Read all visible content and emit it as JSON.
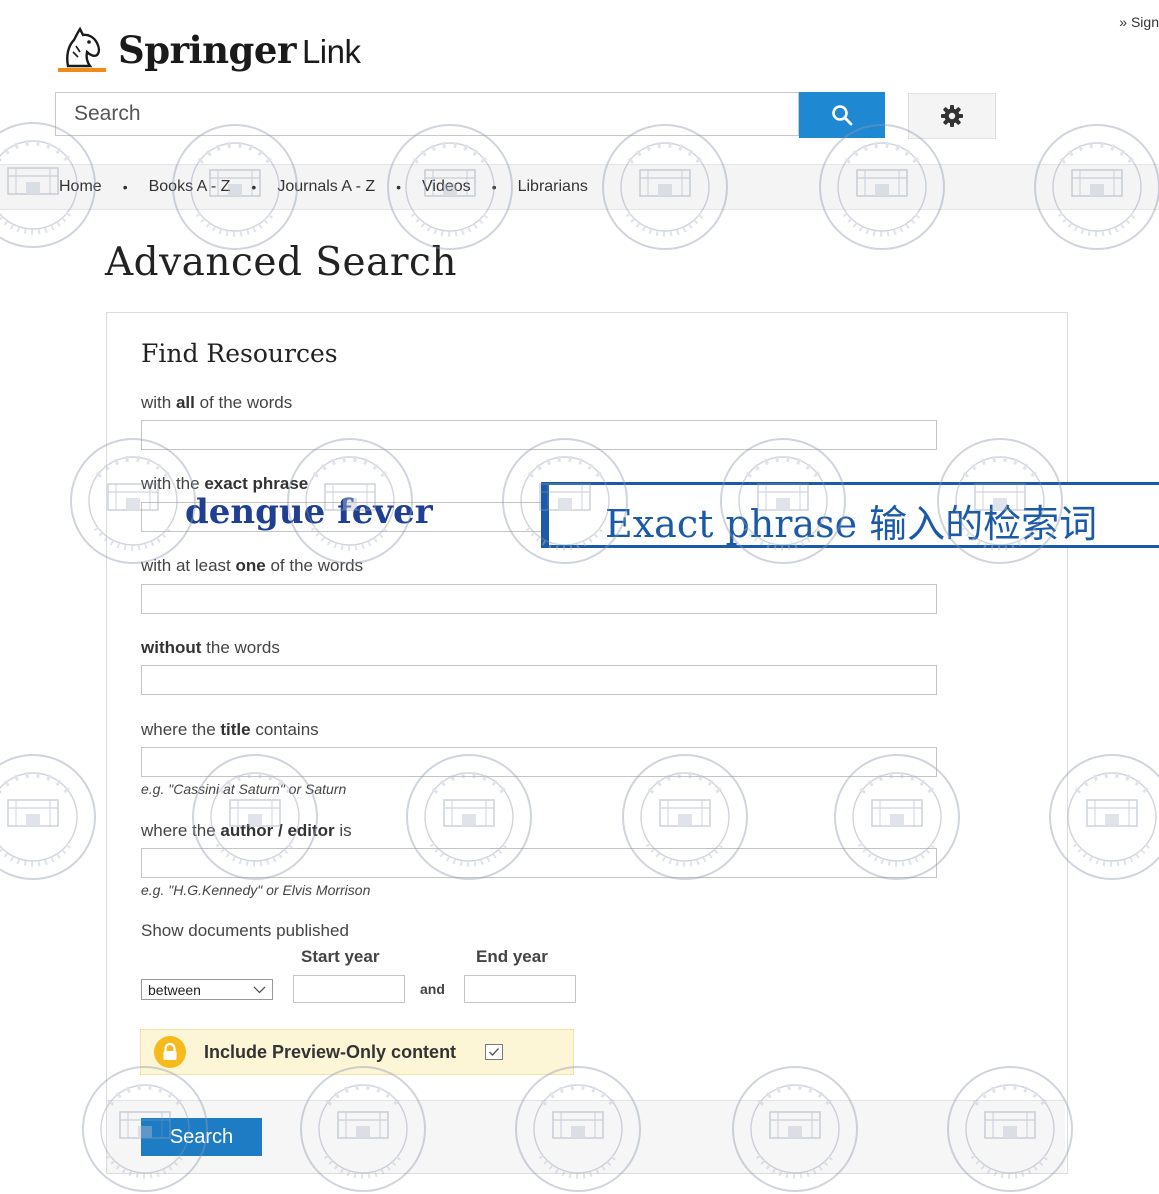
{
  "header": {
    "signin": "» Sign",
    "brand_bold": "Springer",
    "brand_light": "Link",
    "search_placeholder": "Search"
  },
  "nav": {
    "items": [
      "Home",
      "Books A - Z",
      "Journals A - Z",
      "Videos",
      "Librarians"
    ]
  },
  "page": {
    "title": "Advanced Search"
  },
  "form": {
    "heading": "Find Resources",
    "all_words_pre": "with ",
    "all_words_bold": "all",
    "all_words_post": " of the words",
    "exact_pre": "with the ",
    "exact_bold": "exact phrase",
    "least_pre": "with ",
    "least_mid": "at least ",
    "least_bold": "one",
    "least_post": " of the words",
    "without_bold": "without",
    "without_post": " the words",
    "title_pre": "where the ",
    "title_bold": "title",
    "title_post": " contains",
    "title_hint": "e.g. \"Cassini at Saturn\" or Saturn",
    "author_pre": "where the ",
    "author_bold": "author / editor",
    "author_post": " is",
    "author_hint": "e.g. \"H.G.Kennedy\" or Elvis Morrison",
    "published_label": "Show documents published",
    "start_year_label": "Start year",
    "end_year_label": "End year",
    "range_select": "between",
    "and_label": "and",
    "preview_label": "Include Preview-Only content",
    "submit_label": "Search"
  },
  "annotation": {
    "phrase": "dengue fever",
    "callout": "Exact phrase 输入的检索词"
  },
  "colors": {
    "accent": "#1e88d2",
    "callout": "#1a5aa8",
    "preview_bg": "#fcf5d6",
    "lock": "#f5bb1c"
  },
  "icons": {
    "logo": "horse-head-icon",
    "search": "search-icon",
    "settings": "gear-icon",
    "lock": "lock-icon",
    "checkbox": "checkbox-icon",
    "select": "chevron-down-icon",
    "watermark": "watermark-seal-icon"
  }
}
